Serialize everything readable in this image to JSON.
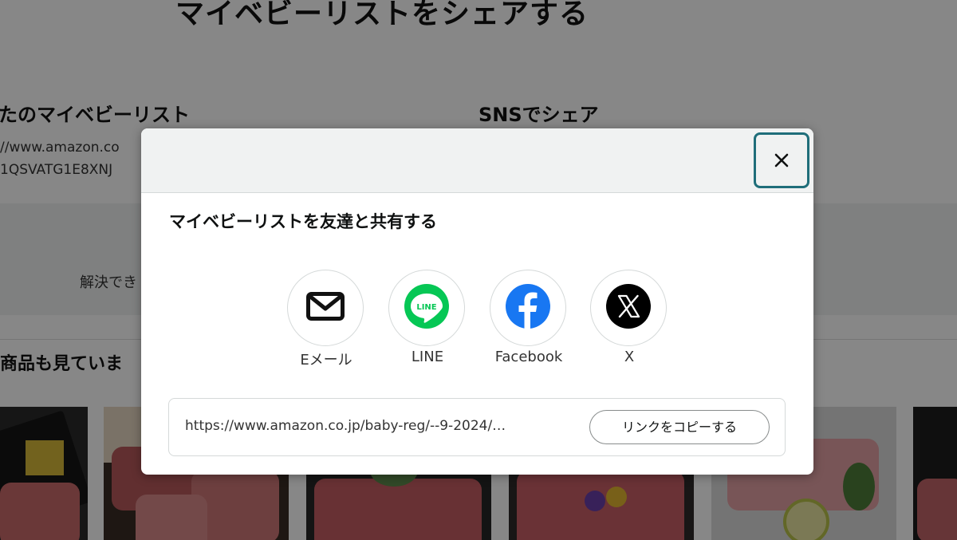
{
  "background_page": {
    "page_title": "マイベビーリストをシェアする",
    "your_list_heading": "たのマイベビーリスト",
    "your_list_url_line1": "//www.amazon.co",
    "your_list_url_line2": "1QSVATG1E8XNJ",
    "sns_heading": "SNSでシェア",
    "resolve_text": "解決でき",
    "also_viewed_heading": "商品も見ていま"
  },
  "modal": {
    "close_label": "×",
    "heading": "マイベビーリストを友達と共有する",
    "share_options": [
      {
        "label": "Eメール",
        "icon": "mail-icon"
      },
      {
        "label": "LINE",
        "icon": "line-icon",
        "icon_text": "LINE",
        "color": "#06c755"
      },
      {
        "label": "Facebook",
        "icon": "facebook-icon",
        "color": "#1877f2"
      },
      {
        "label": "X",
        "icon": "x-icon",
        "color": "#000000"
      }
    ],
    "share_link": "https://www.amazon.co.jp/baby-reg/--9-2024/…",
    "copy_button_label": "リンクをコピーする"
  },
  "colors": {
    "close_focus_ring": "#1f6e7a",
    "overlay": "rgba(0,0,0,0.47)",
    "header_bg": "#f0f2f2"
  }
}
